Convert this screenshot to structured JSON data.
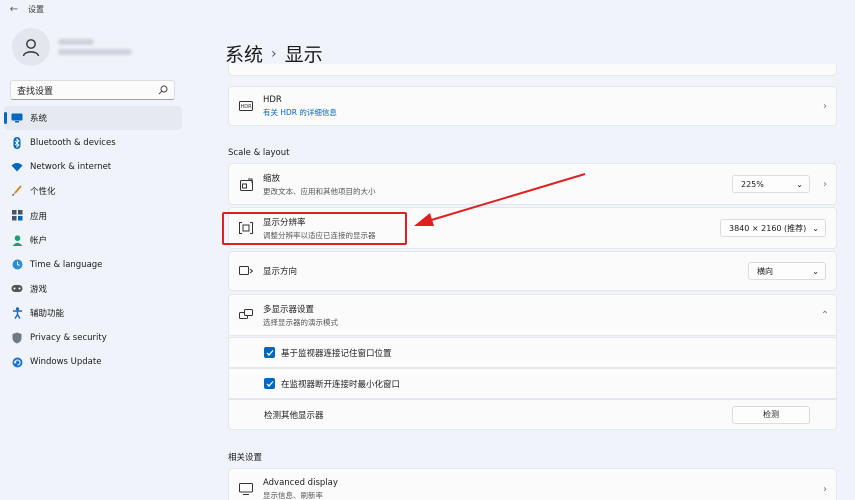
{
  "window": {
    "title": "设置"
  },
  "sidebar": {
    "search_placeholder": "查找设置",
    "items": [
      {
        "label": "系统",
        "icon": "monitor-icon",
        "active": true
      },
      {
        "label": "Bluetooth & devices",
        "icon": "bluetooth-icon"
      },
      {
        "label": "Network & internet",
        "icon": "wifi-icon"
      },
      {
        "label": "个性化",
        "icon": "brush-icon"
      },
      {
        "label": "应用",
        "icon": "apps-icon"
      },
      {
        "label": "帐户",
        "icon": "person-icon"
      },
      {
        "label": "Time & language",
        "icon": "globe-clock-icon"
      },
      {
        "label": "游戏",
        "icon": "gamepad-icon"
      },
      {
        "label": "辅助功能",
        "icon": "accessibility-icon"
      },
      {
        "label": "Privacy & security",
        "icon": "shield-icon"
      },
      {
        "label": "Windows Update",
        "icon": "update-icon"
      }
    ]
  },
  "breadcrumb": {
    "parent": "系统",
    "separator": "›",
    "current": "显示"
  },
  "hdr": {
    "title": "HDR",
    "link": "有关 HDR 的详细信息"
  },
  "scale_layout": {
    "section_label": "Scale & layout",
    "scale": {
      "title": "缩放",
      "subtitle": "更改文本、应用和其他项目的大小",
      "value": "225%"
    },
    "resolution": {
      "title": "显示分辨率",
      "subtitle": "调整分辨率以适应已连接的显示器",
      "value": "3840 × 2160 (推荐)"
    },
    "orientation": {
      "title": "显示方向",
      "value": "横向"
    },
    "multi_display": {
      "title": "多显示器设置",
      "subtitle": "选择显示器的演示模式",
      "options": [
        {
          "label": "基于监视器连接记住窗口位置",
          "checked": true
        },
        {
          "label": "在监视器断开连接时最小化窗口",
          "checked": true
        }
      ],
      "detect_label": "检测其他显示器",
      "detect_button": "检测"
    }
  },
  "related": {
    "section_label": "相关设置",
    "advanced": {
      "title": "Advanced display",
      "subtitle": "显示信息、刷新率"
    }
  },
  "colors": {
    "accent": "#0067c0",
    "highlight": "#e02020"
  }
}
